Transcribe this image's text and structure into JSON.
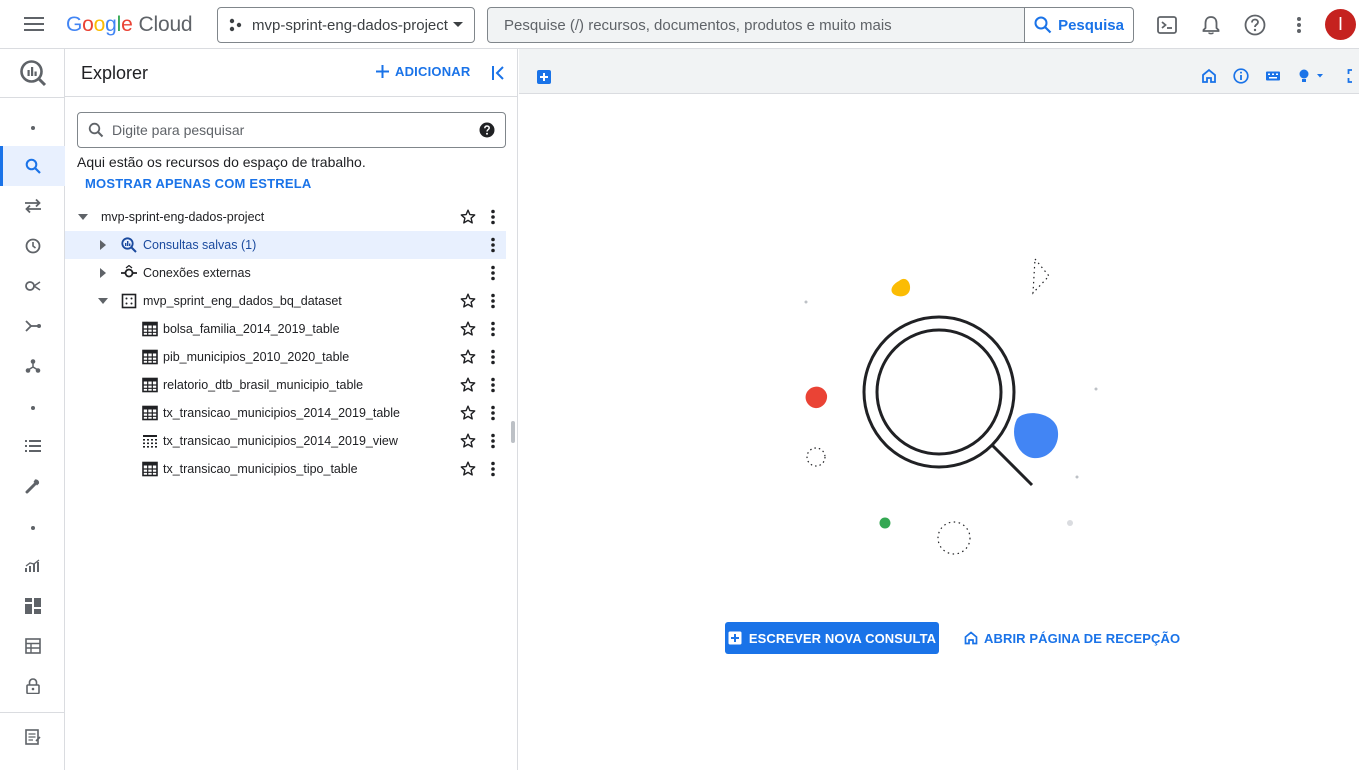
{
  "header": {
    "logo_google": "Google",
    "logo_cloud": "Cloud",
    "project_name": "mvp-sprint-eng-dados-project",
    "search_placeholder": "Pesquise (/) recursos, documentos, produtos e muito mais",
    "search_button": "Pesquisa",
    "avatar_initial": "I",
    "icons": [
      "menu-icon",
      "project-icon",
      "dropdown-icon",
      "search-icon",
      "cloud-shell-icon",
      "notifications-icon",
      "help-icon",
      "more-vert-icon"
    ]
  },
  "rail": {
    "items": [
      "bigquery-logo-icon",
      "dot",
      "search-icon",
      "transfers-icon",
      "scheduled-queries-icon",
      "analytics-hub-icon",
      "dataform-icon",
      "pipelines-icon",
      "dot",
      "jobs-icon",
      "settings-icon",
      "dot",
      "monitoring-icon",
      "capacity-icon",
      "table-icon",
      "lock-icon",
      "release-notes-icon"
    ]
  },
  "explorer": {
    "title": "Explorer",
    "add_label": "ADICIONAR",
    "search_placeholder": "Digite para pesquisar",
    "description": "Aqui estão os recursos do espaço de trabalho.",
    "starred_link": "MOSTRAR APENAS COM ESTRELA",
    "tree": [
      {
        "label": "mvp-sprint-eng-dados-project",
        "level": 0,
        "caret": "down",
        "icon": "none",
        "star": true,
        "kebab": true,
        "selected": false
      },
      {
        "label": "Consultas salvas (1)",
        "level": 1,
        "caret": "right",
        "icon": "saved-query",
        "star": false,
        "kebab": true,
        "selected": true
      },
      {
        "label": "Conexões externas",
        "level": 1,
        "caret": "right",
        "icon": "connection",
        "star": false,
        "kebab": true,
        "selected": false
      },
      {
        "label": "mvp_sprint_eng_dados_bq_dataset",
        "level": 1,
        "caret": "down",
        "icon": "dataset",
        "star": true,
        "kebab": true,
        "selected": false
      },
      {
        "label": "bolsa_familia_2014_2019_table",
        "level": 2,
        "caret": "none",
        "icon": "table",
        "star": true,
        "kebab": true,
        "selected": false
      },
      {
        "label": "pib_municipios_2010_2020_table",
        "level": 2,
        "caret": "none",
        "icon": "table",
        "star": true,
        "kebab": true,
        "selected": false
      },
      {
        "label": "relatorio_dtb_brasil_municipio_table",
        "level": 2,
        "caret": "none",
        "icon": "table",
        "star": true,
        "kebab": true,
        "selected": false
      },
      {
        "label": "tx_transicao_municipios_2014_2019_table",
        "level": 2,
        "caret": "none",
        "icon": "table",
        "star": true,
        "kebab": true,
        "selected": false
      },
      {
        "label": "tx_transicao_municipios_2014_2019_view",
        "level": 2,
        "caret": "none",
        "icon": "view",
        "star": true,
        "kebab": true,
        "selected": false
      },
      {
        "label": "tx_transicao_municipios_tipo_table",
        "level": 2,
        "caret": "none",
        "icon": "table",
        "star": true,
        "kebab": true,
        "selected": false
      }
    ]
  },
  "main": {
    "toolbar_icons": [
      "new-tab-icon",
      "home-icon",
      "info-icon",
      "keyboard-icon",
      "lightbulb-icon",
      "fullscreen-icon"
    ],
    "new_query_button": "ESCREVER NOVA CONSULTA",
    "welcome_button": "ABRIR PÁGINA DE RECEPÇÃO"
  },
  "colors": {
    "accent": "#1a73e8",
    "selected_row": "#e8f0fe",
    "avatar": "#c5221f",
    "illustration_yellow": "#fbbc04",
    "illustration_red": "#ea4335",
    "illustration_blue": "#4285f4",
    "illustration_green": "#34a853"
  }
}
